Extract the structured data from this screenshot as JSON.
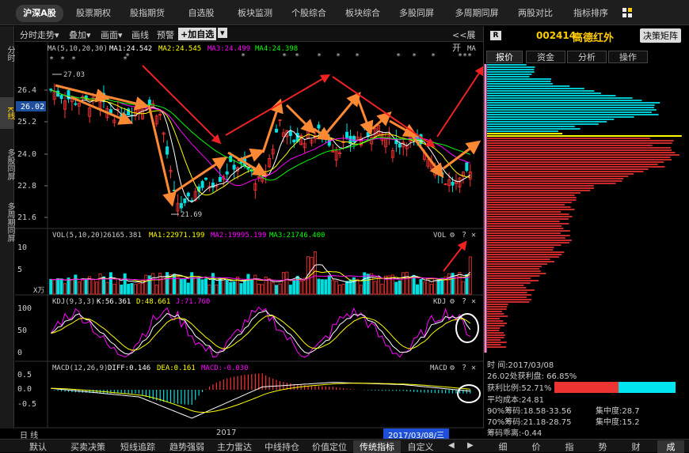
{
  "nav": {
    "market": "沪深A股",
    "items": [
      "股票期权",
      "股指期货",
      "自选股",
      "板块监测",
      "个股综合",
      "板块综合",
      "多股同屏",
      "多周期同屏",
      "两股对比",
      "指标排序"
    ]
  },
  "left_tabs": [
    "分时",
    "K线",
    "多股同屏",
    "多周期同屏"
  ],
  "toolbar": {
    "items": [
      "分时走势▾",
      "叠加▾",
      "画面▾",
      "画线",
      "预警"
    ],
    "add_fav": "+加自选",
    "expand": "<<展开"
  },
  "stock": {
    "badge": "R",
    "code": "002414",
    "name": "高德红外",
    "decision": "决策矩阵"
  },
  "right_tabs": [
    "报价",
    "资金",
    "分析",
    "操作"
  ],
  "ma_line": {
    "label": "MA(5,10,20,30)",
    "ma1": "MA1:24.542",
    "ma2": "MA2:24.545",
    "ma3": "MA3:24.499",
    "ma4": "MA4:24.398",
    "right": "MA"
  },
  "price_axis": [
    "26.4",
    "25.2",
    "24.0",
    "22.8",
    "21.6"
  ],
  "price_current": "26.02",
  "price_hi": "27.03",
  "price_lo": "21.69",
  "vol_line": {
    "label": "VOL(5,10,20)",
    "v": "26165.381",
    "ma1": "MA1:22971.199",
    "ma2": "MA2:19995.199",
    "ma3": "MA3:21746.400",
    "right": "VOL"
  },
  "vol_axis": [
    "10",
    "5"
  ],
  "vol_unit": "X万",
  "kdj_line": {
    "label": "KDJ(9,3,3)",
    "k": "K:56.361",
    "d": "D:48.661",
    "j": "J:71.760",
    "right": "KDJ"
  },
  "kdj_axis": [
    "100",
    "50",
    "0"
  ],
  "macd_line": {
    "label": "MACD(12,26,9)",
    "diff": "DIFF:0.146",
    "dea": "DEA:0.161",
    "macd": "MACD:-0.030",
    "right": "MACD"
  },
  "macd_axis": [
    "0.5",
    "0.0",
    "-0.5"
  ],
  "x_axis": {
    "period": "日 线",
    "year": "2017",
    "cursor": "2017/03/08/三"
  },
  "chip": {
    "time_label": "时      间:2017/03/08",
    "profit_price": "26.02处获利盘: 66.85%",
    "profit_ratio": "获利比例:52.71%",
    "avg_cost": "平均成本:24.81",
    "c90": "90%筹码:18.58-33.56",
    "c90_conc": "集中度:28.7",
    "c70": "70%筹码:21.18-28.75",
    "c70_conc": "集中度:15.2",
    "diverge": "筹码乖离:-0.44",
    "profit_frac": 0.5271
  },
  "bottom_tabs": [
    "默认",
    "买卖决策",
    "短线追踪",
    "趋势强弱",
    "主力雷达",
    "中线持仓",
    "价值定位",
    "传统指标",
    "自定义"
  ],
  "right_bottom_tabs": [
    "细",
    "价",
    "指",
    "势",
    "财",
    "成"
  ],
  "colors": {
    "up": "#ff3333",
    "down": "#00e0e0",
    "ma1": "#ffffff",
    "ma2": "#ffff00",
    "ma3": "#ff00ff",
    "ma4": "#00ff00",
    "arrow": "#ff8833"
  }
}
